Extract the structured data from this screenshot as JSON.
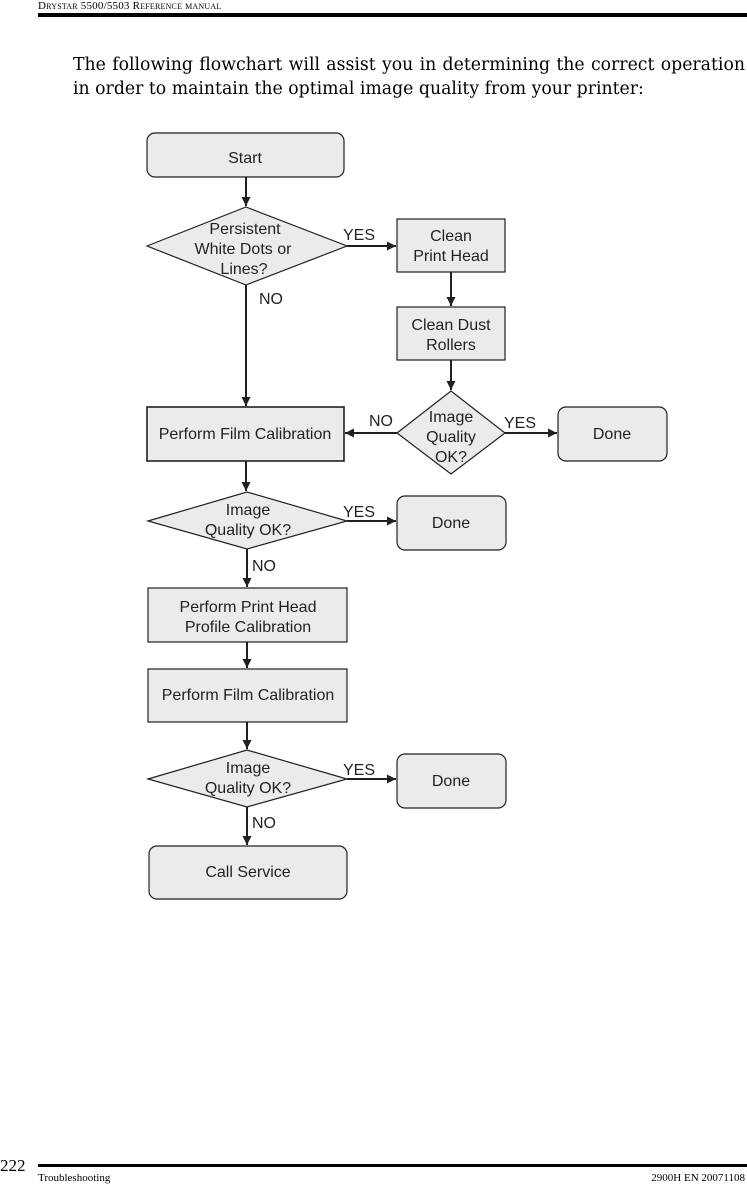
{
  "header": {
    "title": "Drystar 5500/5503 Reference manual"
  },
  "intro": "The following flowchart will assist you in determining the correct operation in order to maintain the optimal image quality from your printer:",
  "flowchart": {
    "nodes": {
      "start": [
        "Start"
      ],
      "persistent": [
        "Persistent",
        "White Dots or",
        "Lines?"
      ],
      "clean_head": [
        "Clean",
        "Print Head"
      ],
      "clean_rollers": [
        "Clean Dust",
        "Rollers"
      ],
      "iq1": [
        "Image",
        "Quality",
        "OK?"
      ],
      "done1": [
        "Done"
      ],
      "film_cal1": [
        "Perform Film Calibration"
      ],
      "iq2": [
        "Image",
        "Quality OK?"
      ],
      "done2": [
        "Done"
      ],
      "profile_cal": [
        "Perform Print Head",
        "Profile Calibration"
      ],
      "film_cal2": [
        "Perform Film Calibration"
      ],
      "iq3": [
        "Image",
        "Quality OK?"
      ],
      "done3": [
        "Done"
      ],
      "call_service": [
        "Call Service"
      ]
    },
    "labels": {
      "yes": "YES",
      "no": "NO"
    }
  },
  "footer": {
    "page": "222",
    "section": "Troubleshooting",
    "doc": "2900H EN 20071108"
  },
  "colors": {
    "box_fill": "#ebebec",
    "stroke": "#231f20"
  }
}
